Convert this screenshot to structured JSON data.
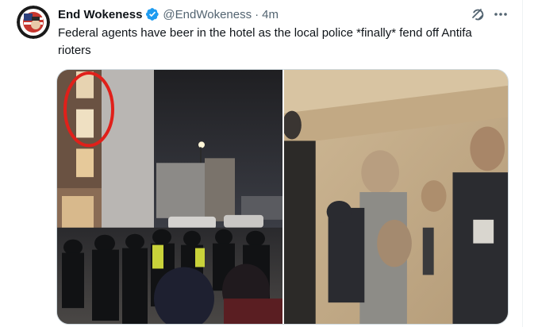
{
  "tweet": {
    "author": {
      "display_name": "End Wokeness",
      "handle": "@EndWokeness",
      "verified": true,
      "verified_icon": "verified-badge-icon",
      "avatar_icon": "avatar-logo"
    },
    "separator": "·",
    "time": "4m",
    "text": "Federal agents have beer in the hotel as the local police *finally* fend off Antifa rioters",
    "actions": {
      "grok_icon": "grok-icon",
      "more_icon": "more-icon"
    },
    "media": {
      "count": 2,
      "photos": [
        {
          "name": "riot-police-outside-hotel-photo"
        },
        {
          "name": "agents-inside-hotel-photo"
        }
      ]
    }
  },
  "colors": {
    "text_primary": "#0f1419",
    "text_secondary": "#536471",
    "verified_blue": "#1d9bf0",
    "border": "#cfd9de",
    "annotation_red": "#e0201a"
  }
}
